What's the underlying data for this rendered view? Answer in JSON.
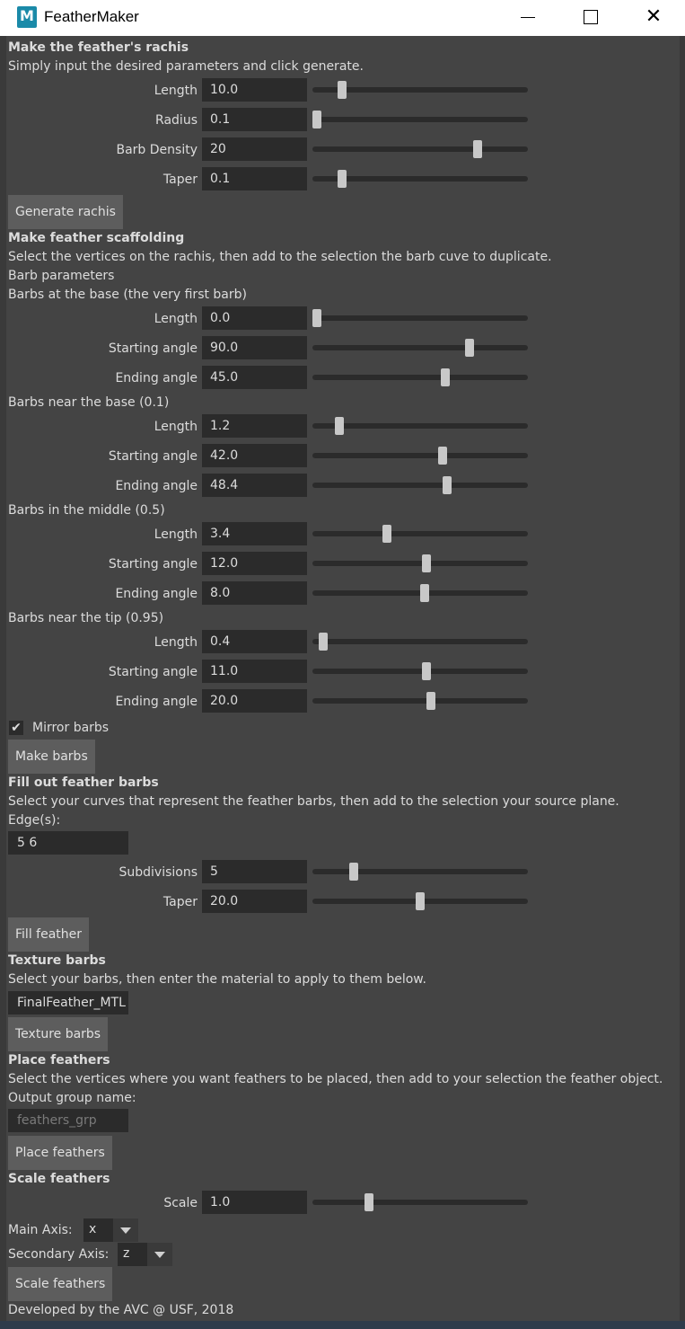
{
  "window": {
    "title": "FeatherMaker",
    "icon_letter": "M",
    "controls": [
      "minimize-icon",
      "maximize-icon",
      "close-icon"
    ],
    "close_glyph": "✕"
  },
  "rachis": {
    "heading": "Make the feather's rachis",
    "description": "Simply input the desired parameters and click generate.",
    "rows": [
      {
        "label": "Length",
        "value": "10.0",
        "slider": 0.12
      },
      {
        "label": "Radius",
        "value": "0.1",
        "slider": 0.0
      },
      {
        "label": "Barb Density",
        "value": "20",
        "slider": 0.78
      },
      {
        "label": "Taper",
        "value": "0.1",
        "slider": 0.12
      }
    ],
    "button": "Generate rachis"
  },
  "scaffolding": {
    "heading": "Make feather scaffolding",
    "description": "Select the vertices on the rachis, then add to the selection the barb cuve to duplicate.",
    "params_label": "Barb parameters",
    "groups": [
      {
        "title": "Barbs at the base (the very first barb)",
        "rows": [
          {
            "label": "Length",
            "value": "0.0",
            "slider": 0.0
          },
          {
            "label": "Starting angle",
            "value": "90.0",
            "slider": 0.74
          },
          {
            "label": "Ending angle",
            "value": "45.0",
            "slider": 0.62
          }
        ]
      },
      {
        "title": "Barbs near the base (0.1)",
        "rows": [
          {
            "label": "Length",
            "value": "1.2",
            "slider": 0.11
          },
          {
            "label": "Starting angle",
            "value": "42.0",
            "slider": 0.61
          },
          {
            "label": "Ending angle",
            "value": "48.4",
            "slider": 0.63
          }
        ]
      },
      {
        "title": "Barbs in the middle (0.5)",
        "rows": [
          {
            "label": "Length",
            "value": "3.4",
            "slider": 0.34
          },
          {
            "label": "Starting angle",
            "value": "12.0",
            "slider": 0.53
          },
          {
            "label": "Ending angle",
            "value": "8.0",
            "slider": 0.52
          }
        ]
      },
      {
        "title": "Barbs near the tip (0.95)",
        "rows": [
          {
            "label": "Length",
            "value": "0.4",
            "slider": 0.03
          },
          {
            "label": "Starting angle",
            "value": "11.0",
            "slider": 0.53
          },
          {
            "label": "Ending angle",
            "value": "20.0",
            "slider": 0.55
          }
        ]
      }
    ],
    "mirror_label": "Mirror barbs",
    "mirror_checked": true,
    "button": "Make barbs"
  },
  "fill": {
    "heading": "Fill out feather barbs",
    "description": "Select your curves that represent the feather barbs, then add to the selection your source plane.",
    "edges_label": "Edge(s):",
    "edges_value": "5 6",
    "rows": [
      {
        "label": "Subdivisions",
        "value": "5",
        "slider": 0.18
      },
      {
        "label": "Taper",
        "value": "20.0",
        "slider": 0.5
      }
    ],
    "button": "Fill feather"
  },
  "texture": {
    "heading": "Texture barbs",
    "description": "Select your barbs, then enter the material to apply to them below.",
    "material_value": "FinalFeather_MTL",
    "button": "Texture barbs"
  },
  "place": {
    "heading": "Place feathers",
    "description": "Select the vertices where you want feathers to be placed, then add to your selection the feather object.",
    "group_label": "Output group name:",
    "group_placeholder": "feathers_grp",
    "button": "Place feathers"
  },
  "scale": {
    "heading": "Scale feathers",
    "row": {
      "label": "Scale",
      "value": "1.0",
      "slider": 0.25
    },
    "main_axis_label": "Main Axis:",
    "main_axis_value": "x",
    "secondary_axis_label": "Secondary Axis:",
    "secondary_axis_value": "z",
    "button": "Scale feathers"
  },
  "footer": "Developed by the AVC @ USF, 2018"
}
